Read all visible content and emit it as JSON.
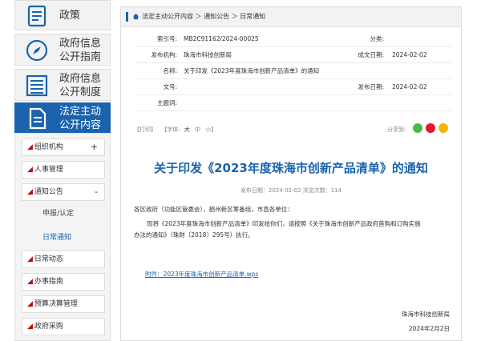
{
  "sidebar": {
    "tabs": [
      {
        "icon": "document-icon",
        "label": "政策"
      },
      {
        "icon": "compass-icon",
        "label": "政府信息\n公开指南"
      },
      {
        "icon": "list-icon",
        "label": "政府信息\n公开制度"
      },
      {
        "icon": "file-icon",
        "label": "法定主动\n公开内容"
      }
    ],
    "menu": [
      {
        "label": "组织机构",
        "toggle": "+"
      },
      {
        "label": "人事管理",
        "toggle": ""
      },
      {
        "label": "通知公告",
        "toggle": "-"
      },
      {
        "label": "日常动态",
        "toggle": ""
      },
      {
        "label": "办事指南",
        "toggle": ""
      },
      {
        "label": "预算决算管理",
        "toggle": ""
      },
      {
        "label": "政府采购",
        "toggle": ""
      }
    ],
    "submenu": [
      "申报/认定",
      "日常通知"
    ]
  },
  "breadcrumb": "法定主动公开内容 ＞ 通知公告 ＞ 日常通知",
  "meta": {
    "index_label": "索引号:",
    "index_value": "MB2C91162/2024-00025",
    "category_label": "分类:",
    "category_value": "",
    "publisher_label": "发布机构:",
    "publisher_value": "珠海市科技创新局",
    "created_label": "成文日期:",
    "created_value": "2024-02-02",
    "name_label": "名称:",
    "name_value": "关于印发《2023年度珠海市创新产品清单》的通知",
    "docno_label": "文号:",
    "docno_value": "",
    "pubdate_label": "发布日期:",
    "pubdate_value": "2024-02-02",
    "subject_label": "主题词:",
    "subject_value": ""
  },
  "tools": {
    "print": "【打印】",
    "font_label": "【字体:",
    "font_big": "大",
    "font_mid": "中",
    "font_small": "小】",
    "share": "分享到:"
  },
  "article": {
    "title": "关于印发《2023年度珠海市创新产品清单》的通知",
    "submeta": "发布日期：2024-02-02  浏览次数：114",
    "greeting": "各区政府（功能区管委会），鹤州新区筹备组，市直各单位：",
    "para1": "现将《2023年度珠海市创新产品清单》印发给你们，请按照《关于珠海市创新产品政府首购和订购实施",
    "para2": "办法的通知》（珠财〔2018〕295号）执行。",
    "attachment": "附件：2023年度珠海市创新产品清单.wps",
    "signer": "珠海市科技创新局",
    "date": "2024年2月2日"
  },
  "colors": {
    "accent": "#1b63ad",
    "mark": "#cc0000",
    "wechat": "#4cb848",
    "weibo": "#e6162d",
    "qzone": "#f5b400"
  }
}
